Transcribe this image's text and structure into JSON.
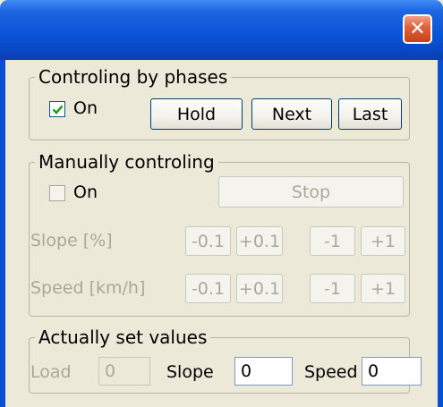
{
  "window": {
    "close_label": "✕"
  },
  "phases": {
    "legend": "Controling by phases",
    "on_label": "On",
    "on_checked": true,
    "hold_label": "Hold",
    "next_label": "Next",
    "last_label": "Last"
  },
  "manual": {
    "legend": "Manually controling",
    "on_label": "On",
    "on_checked": false,
    "stop_label": "Stop",
    "slope_label": "Slope [%]",
    "speed_label": "Speed [km/h]",
    "slope_buttons": [
      "-0.1",
      "+0.1",
      "-1",
      "+1"
    ],
    "speed_buttons": [
      "-0.1",
      "+0.1",
      "-1",
      "+1"
    ]
  },
  "actual": {
    "legend": "Actually set values",
    "load_label": "Load",
    "load_value": "0",
    "slope_label": "Slope",
    "slope_value": "0",
    "speed_label": "Speed",
    "speed_value": "0"
  }
}
